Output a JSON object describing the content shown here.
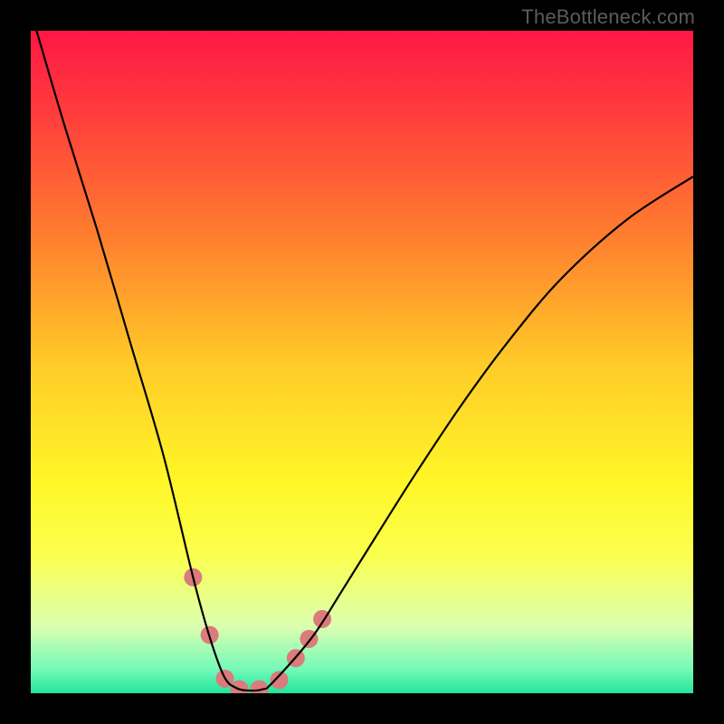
{
  "chart_data": {
    "type": "line",
    "title": "",
    "xlabel": "",
    "ylabel": "",
    "xlim": [
      0,
      1
    ],
    "ylim": [
      0,
      1
    ],
    "series": [
      {
        "name": "bottleneck-curve",
        "x": [
          0.0,
          0.05,
          0.1,
          0.15,
          0.2,
          0.245,
          0.27,
          0.292,
          0.31,
          0.33,
          0.35,
          0.365,
          0.425,
          0.47,
          0.52,
          0.58,
          0.65,
          0.72,
          0.8,
          0.9,
          1.0
        ],
        "y": [
          1.03,
          0.86,
          0.7,
          0.53,
          0.36,
          0.175,
          0.085,
          0.025,
          0.008,
          0.004,
          0.006,
          0.016,
          0.085,
          0.155,
          0.235,
          0.33,
          0.435,
          0.53,
          0.625,
          0.715,
          0.78
        ],
        "color": "#000000",
        "width": 2.2
      }
    ],
    "markers": {
      "name": "bottleneck-points",
      "color": "#db7b7b",
      "radius": 10,
      "points": [
        {
          "x": 0.245,
          "y": 0.175
        },
        {
          "x": 0.27,
          "y": 0.088
        },
        {
          "x": 0.293,
          "y": 0.022
        },
        {
          "x": 0.315,
          "y": 0.006
        },
        {
          "x": 0.345,
          "y": 0.006
        },
        {
          "x": 0.375,
          "y": 0.02
        },
        {
          "x": 0.4,
          "y": 0.053
        },
        {
          "x": 0.42,
          "y": 0.082
        },
        {
          "x": 0.44,
          "y": 0.112
        }
      ]
    },
    "background_gradient": {
      "stops": [
        {
          "offset": 0.0,
          "color": "#ff1744"
        },
        {
          "offset": 0.12,
          "color": "#ff3b3d"
        },
        {
          "offset": 0.3,
          "color": "#ff7a2f"
        },
        {
          "offset": 0.5,
          "color": "#ffca28"
        },
        {
          "offset": 0.68,
          "color": "#fff627"
        },
        {
          "offset": 0.79,
          "color": "#fbff4d"
        },
        {
          "offset": 0.9,
          "color": "#dbffb0"
        },
        {
          "offset": 0.965,
          "color": "#71f9b8"
        },
        {
          "offset": 1.0,
          "color": "#22e59a"
        }
      ]
    }
  },
  "watermark": "TheBottleneck.com"
}
